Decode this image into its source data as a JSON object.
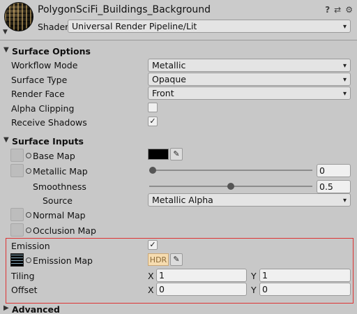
{
  "header": {
    "material_name": "PolygonSciFi_Buildings_Background",
    "shader_label": "Shader",
    "shader_value": "Universal Render Pipeline/Lit",
    "icons": [
      "help-icon",
      "preset-icon",
      "settings-icon"
    ]
  },
  "surface_options": {
    "title": "Surface Options",
    "workflow_mode": {
      "label": "Workflow Mode",
      "value": "Metallic"
    },
    "surface_type": {
      "label": "Surface Type",
      "value": "Opaque"
    },
    "render_face": {
      "label": "Render Face",
      "value": "Front"
    },
    "alpha_clipping": {
      "label": "Alpha Clipping",
      "checked": false
    },
    "receive_shadows": {
      "label": "Receive Shadows",
      "checked": true,
      "mark": "✓"
    }
  },
  "surface_inputs": {
    "title": "Surface Inputs",
    "base_map": {
      "label": "Base Map",
      "color": "#000000"
    },
    "metallic_map": {
      "label": "Metallic Map",
      "value": "0",
      "slider_fraction": 0.0
    },
    "smoothness": {
      "label": "Smoothness",
      "value": "0.5",
      "slider_fraction": 0.5
    },
    "source": {
      "label": "Source",
      "value": "Metallic Alpha"
    },
    "normal_map": {
      "label": "Normal Map"
    },
    "occlusion_map": {
      "label": "Occlusion Map"
    },
    "emission": {
      "label": "Emission",
      "checked": true,
      "mark": "✓"
    },
    "emission_map": {
      "label": "Emission Map",
      "hdr_label": "HDR"
    },
    "tiling": {
      "label": "Tiling",
      "x_label": "X",
      "x": "1",
      "y_label": "Y",
      "y": "1"
    },
    "offset": {
      "label": "Offset",
      "x_label": "X",
      "x": "0",
      "y_label": "Y",
      "y": "0"
    }
  },
  "advanced": {
    "title": "Advanced"
  },
  "glyphs": {
    "tri_down": "▼",
    "tri_right": "▶",
    "chev": "▾",
    "eyedropper": "✎",
    "help": "?",
    "preset": "⇄",
    "gear": "⚙"
  }
}
